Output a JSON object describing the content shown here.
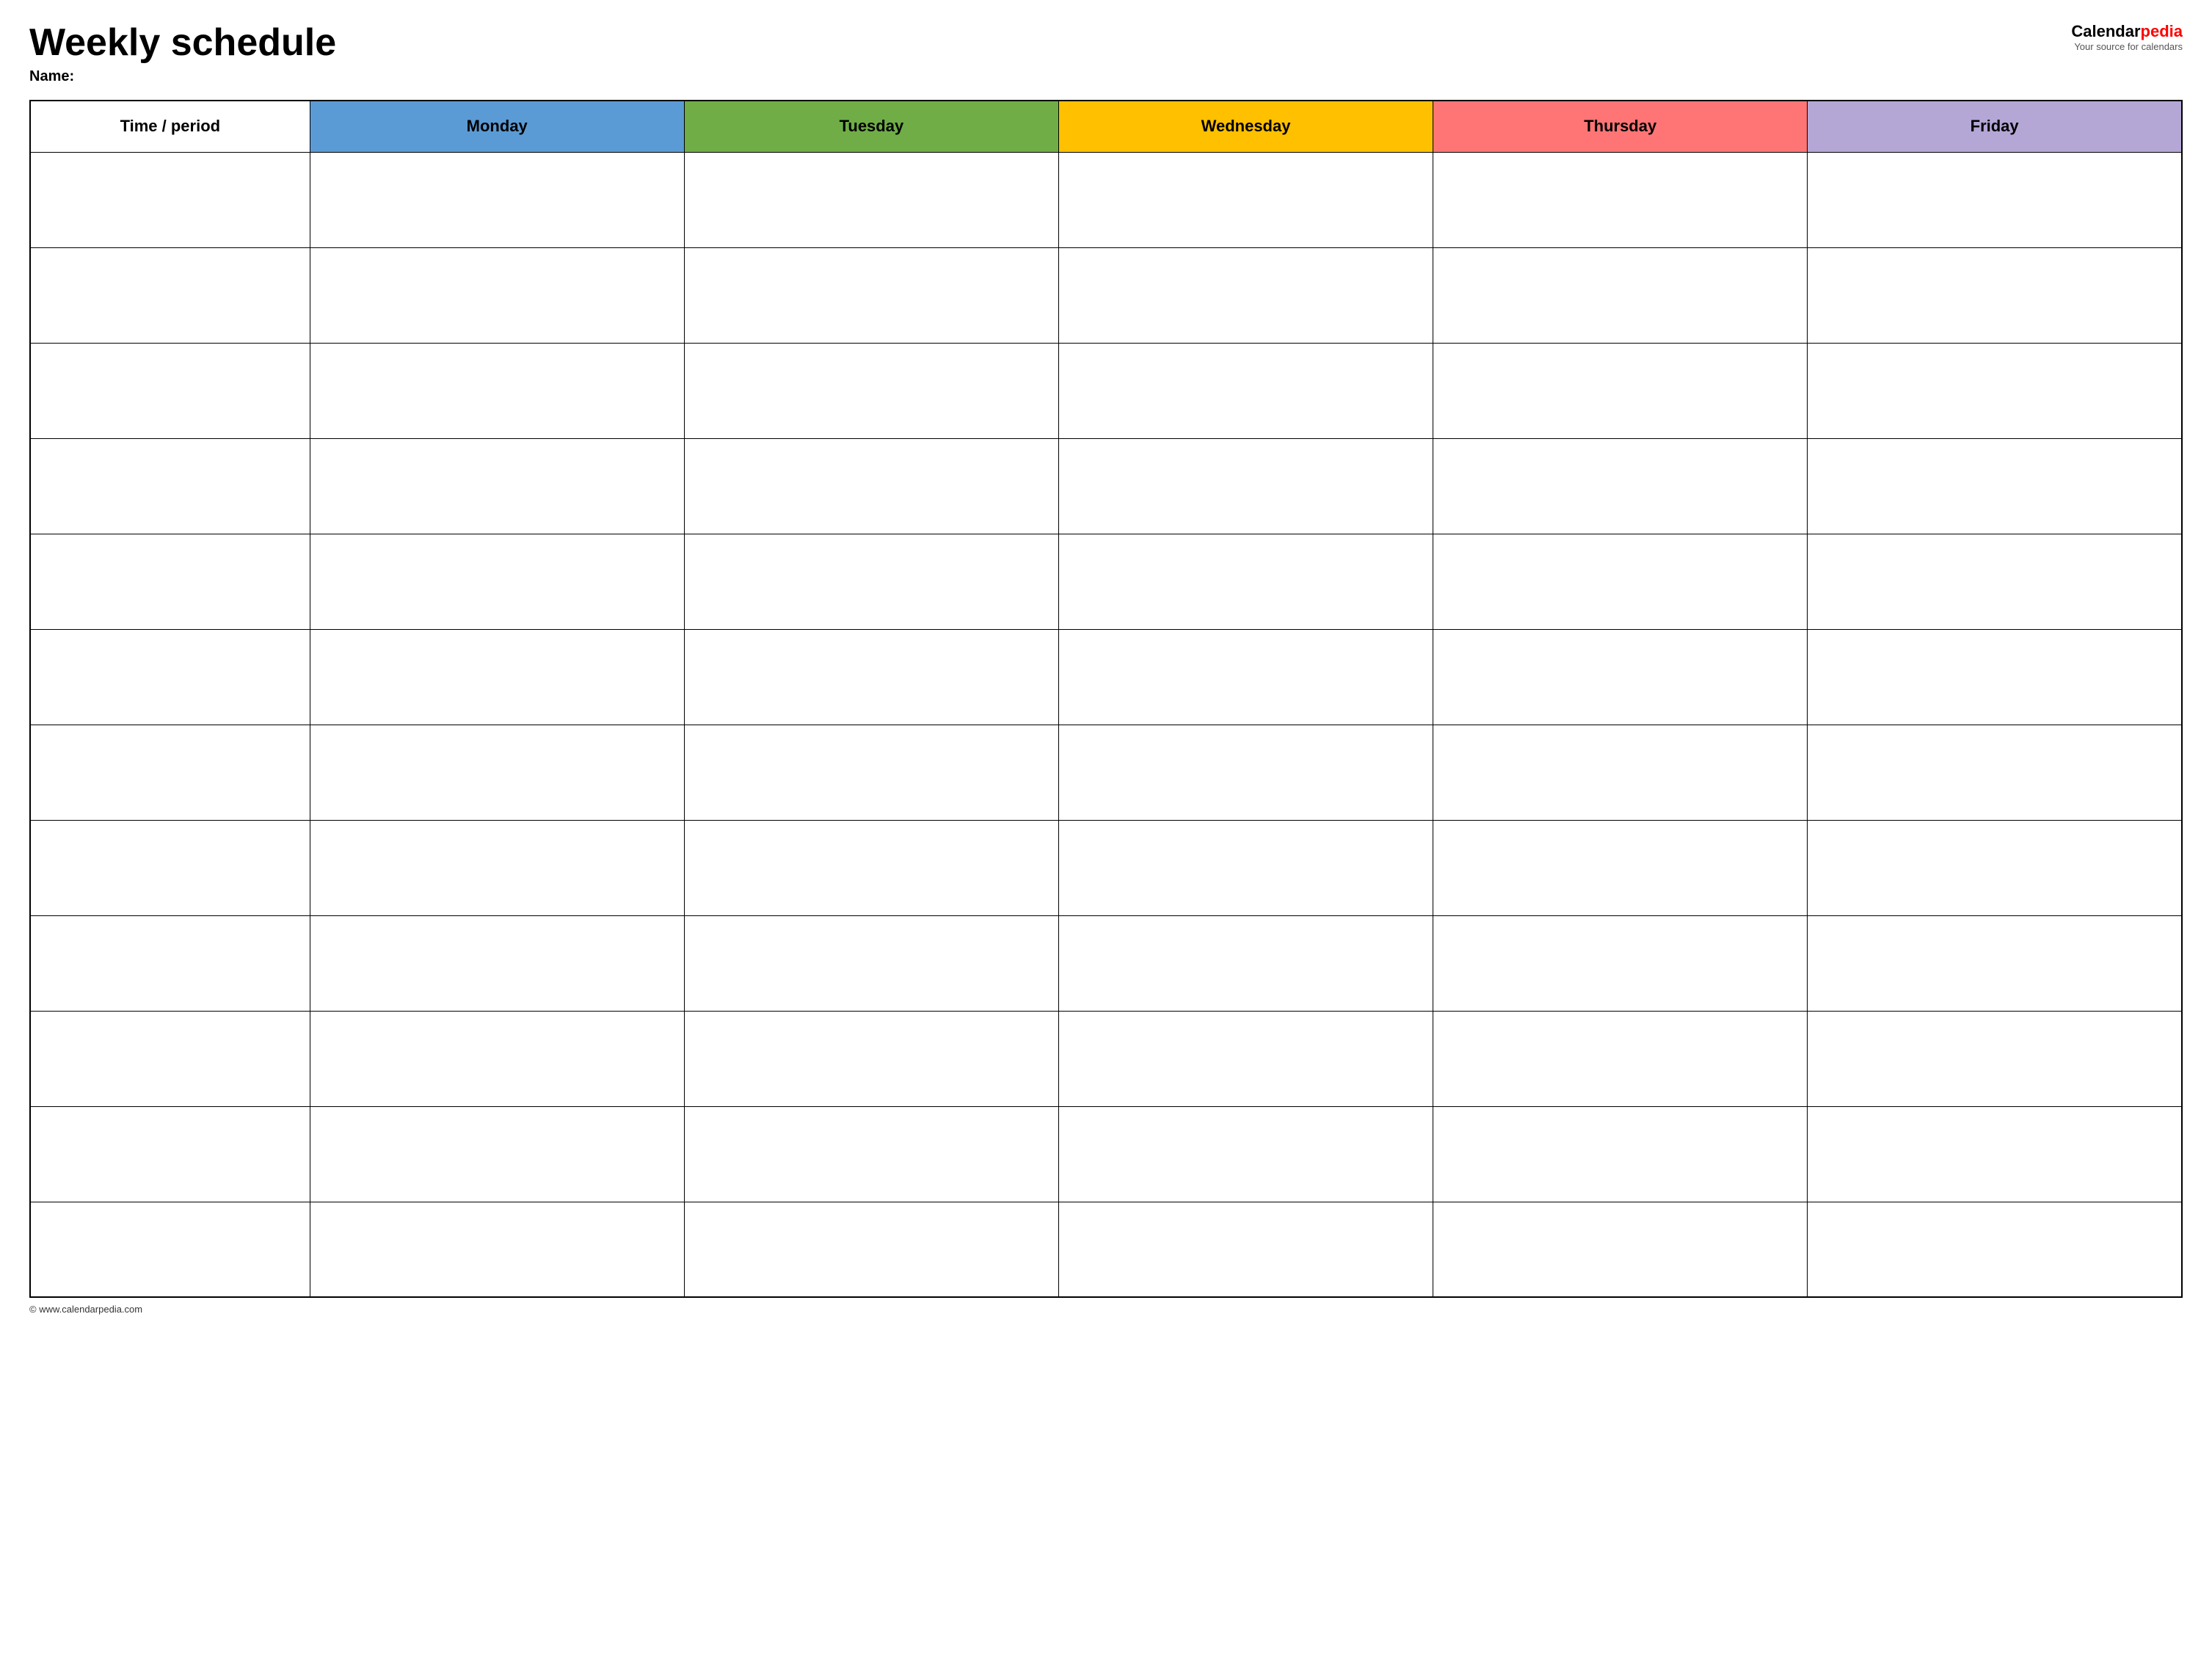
{
  "header": {
    "title": "Weekly schedule",
    "name_label": "Name:",
    "logo_calendar": "Calendar",
    "logo_pedia": "pedia",
    "logo_subtitle": "Your source for calendars"
  },
  "table": {
    "columns": [
      {
        "key": "time",
        "label": "Time / period",
        "color": "#ffffff"
      },
      {
        "key": "monday",
        "label": "Monday",
        "color": "#5b9bd5"
      },
      {
        "key": "tuesday",
        "label": "Tuesday",
        "color": "#70ad47"
      },
      {
        "key": "wednesday",
        "label": "Wednesday",
        "color": "#ffc000"
      },
      {
        "key": "thursday",
        "label": "Thursday",
        "color": "#ff7575"
      },
      {
        "key": "friday",
        "label": "Friday",
        "color": "#b4a7d6"
      }
    ],
    "row_count": 12
  },
  "footer": {
    "url": "© www.calendarpedia.com"
  }
}
